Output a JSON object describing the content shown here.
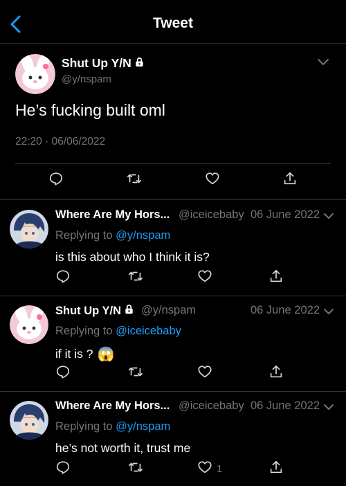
{
  "header": {
    "title": "Tweet"
  },
  "main_tweet": {
    "name": "Shut Up Y/N",
    "handle": "@y/nspam",
    "text": "He’s fucking built oml",
    "timestamp": "22:20 · 06/06/2022"
  },
  "replies": [
    {
      "name": "Where Are My Hors...",
      "handle": "@iceicebaby",
      "date": "06 June 2022",
      "replying_prefix": "Replying to",
      "replying_to": "@y/nspam",
      "text": "is this about who I think it is?",
      "likes": ""
    },
    {
      "name": "Shut Up Y/N",
      "handle": "@y/nspam",
      "date": "06 June 2022",
      "replying_prefix": "Replying to",
      "replying_to": "@iceicebaby",
      "text": "if it is ?",
      "emoji": "😱",
      "likes": ""
    },
    {
      "name": "Where Are My Hors...",
      "handle": "@iceicebaby",
      "date": "06 June 2022",
      "replying_prefix": "Replying to",
      "replying_to": "@y/nspam",
      "text": "he’s not worth it, trust me",
      "likes": "1"
    }
  ],
  "icons": [
    "back-arrow-icon",
    "lock-icon",
    "chevron-down-icon",
    "reply-icon",
    "retweet-icon",
    "like-icon",
    "share-icon"
  ],
  "colors": {
    "background": "#000000",
    "accent": "#1d9bf0",
    "muted": "#71767b",
    "divider": "#2f3336"
  }
}
